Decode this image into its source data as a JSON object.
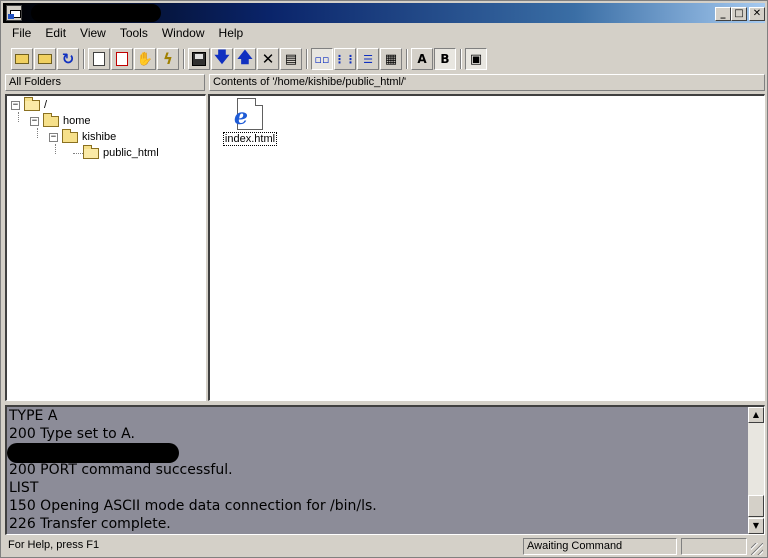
{
  "window": {
    "title": "",
    "buttons": {
      "minimize": "_",
      "maximize": "□",
      "close": "✕"
    }
  },
  "menu": {
    "items": [
      {
        "label": "File"
      },
      {
        "label": "Edit"
      },
      {
        "label": "View"
      },
      {
        "label": "Tools"
      },
      {
        "label": "Window"
      },
      {
        "label": "Help"
      }
    ]
  },
  "toolbar": {
    "buttons": [
      {
        "name": "parent-folder-icon"
      },
      {
        "name": "open-folder-icon"
      },
      {
        "name": "refresh-icon"
      },
      {
        "name": "new-file-icon"
      },
      {
        "name": "delete-file-icon"
      },
      {
        "name": "stop-hand-icon"
      },
      {
        "name": "lightning-icon"
      },
      {
        "name": "save-disk-icon"
      },
      {
        "name": "download-arrow-icon"
      },
      {
        "name": "upload-arrow-icon"
      },
      {
        "name": "delete-x-icon"
      },
      {
        "name": "properties-icon"
      },
      {
        "name": "large-icons-view-icon"
      },
      {
        "name": "small-icons-view-icon"
      },
      {
        "name": "list-view-icon"
      },
      {
        "name": "details-view-icon"
      },
      {
        "label": "A",
        "name": "ascii-mode-button"
      },
      {
        "label": "B",
        "name": "binary-mode-button"
      },
      {
        "name": "log-window-icon"
      }
    ]
  },
  "left_pane": {
    "header": "All Folders",
    "tree": [
      {
        "label": "/",
        "expander": "−"
      },
      {
        "label": "home",
        "expander": "−"
      },
      {
        "label": "kishibe",
        "expander": "−"
      },
      {
        "label": "public_html"
      }
    ]
  },
  "right_pane": {
    "header": "Contents of '/home/kishibe/public_html/'",
    "files": [
      {
        "name": "index.html",
        "icon": "ie-html-file-icon"
      }
    ]
  },
  "log": {
    "lines": [
      "TYPE A",
      "200 Type set to A.",
      "",
      "200 PORT command successful.",
      "LIST",
      "150 Opening ASCII mode data connection for /bin/ls.",
      "226 Transfer complete."
    ],
    "scroll_up": "▲",
    "scroll_down": "▼"
  },
  "status": {
    "help": "For Help, press F1",
    "state": "Awaiting Command",
    "extra": ""
  }
}
